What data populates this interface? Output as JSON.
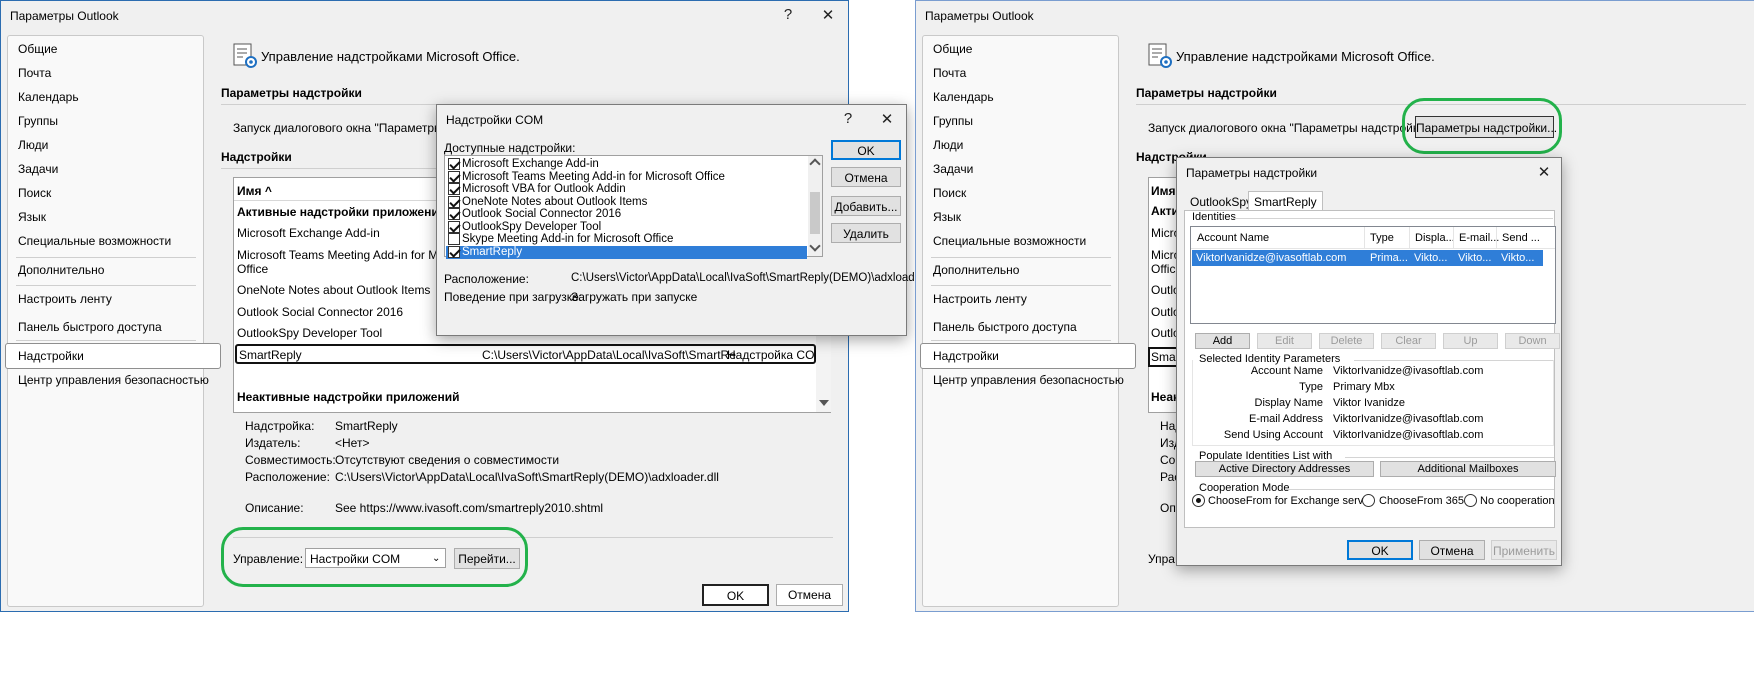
{
  "left": {
    "title": "Параметры Outlook",
    "help": "?",
    "close": "✕",
    "nav": [
      "Общие",
      "Почта",
      "Календарь",
      "Группы",
      "Люди",
      "Задачи",
      "Поиск",
      "Язык",
      "Специальные возможности",
      "Дополнительно",
      "Настроить ленту",
      "Панель быстрого доступа",
      "Надстройки",
      "Центр управления безопасностью"
    ],
    "nav_selected": "Надстройки",
    "header_title": "Управление надстройками Microsoft Office.",
    "params_heading": "Параметры надстройки",
    "params_launch": "Запуск диалогового окна \"Параметры на",
    "addins_heading": "Надстройки",
    "col_name": "Имя ^",
    "active_heading": "Активные надстройки приложений",
    "rows": [
      "Microsoft Exchange Add-in",
      "Microsoft Teams Meeting Add-in for Micro",
      "Office",
      "OneNote Notes about Outlook Items",
      "Outlook Social Connector 2016",
      "OutlookSpy Developer Tool"
    ],
    "sel_row": {
      "name": "SmartReply",
      "path": "C:\\Users\\Victor\\AppData\\Local\\IvaSoft\\SmartRe",
      "type": "Надстройка COM"
    },
    "inactive_heading": "Неактивные надстройки приложений",
    "details": [
      {
        "label": "Надстройка:",
        "value": "SmartReply"
      },
      {
        "label": "Издатель:",
        "value": "<Нет>"
      },
      {
        "label": "Совместимость:",
        "value": "Отсутствуют сведения о совместимости"
      },
      {
        "label": "Расположение:",
        "value": "C:\\Users\\Victor\\AppData\\Local\\IvaSoft\\SmartReply(DEMO)\\adxloader.dll"
      },
      {
        "label": "Описание:",
        "value": "See https://www.ivasoft.com/smartreply2010.shtml"
      }
    ],
    "manage_label": "Управление:",
    "manage_value": "Настройки COM",
    "go_button": "Перейти...",
    "ok": "OK",
    "cancel": "Отмена"
  },
  "com": {
    "title": "Надстройки COM",
    "help": "?",
    "close": "✕",
    "available_label": "Доступные надстройки:",
    "items": [
      {
        "label": "Microsoft Exchange Add-in",
        "checked": true
      },
      {
        "label": "Microsoft Teams Meeting Add-in for Microsoft Office",
        "checked": true
      },
      {
        "label": "Microsoft VBA for Outlook Addin",
        "checked": true
      },
      {
        "label": "OneNote Notes about Outlook Items",
        "checked": true
      },
      {
        "label": "Outlook Social Connector 2016",
        "checked": true
      },
      {
        "label": "OutlookSpy Developer Tool",
        "checked": true
      },
      {
        "label": "Skype Meeting Add-in for Microsoft Office",
        "checked": false
      },
      {
        "label": "SmartReply",
        "checked": true
      }
    ],
    "ok": "OK",
    "cancel": "Отмена",
    "add": "Добавить...",
    "remove": "Удалить",
    "location_label": "Расположение:",
    "location_value": "C:\\Users\\Victor\\AppData\\Local\\IvaSoft\\SmartReply(DEMO)\\adxloader.dll",
    "behavior_label": "Поведение при загрузке:",
    "behavior_value": "Загружать при запуске"
  },
  "right": {
    "title": "Параметры Outlook",
    "nav": [
      "Общие",
      "Почта",
      "Календарь",
      "Группы",
      "Люди",
      "Задачи",
      "Поиск",
      "Язык",
      "Специальные возможности",
      "Дополнительно",
      "Настроить ленту",
      "Панель быстрого доступа",
      "Надстройки",
      "Центр управления безопасностью"
    ],
    "nav_selected": "Надстройки",
    "header_title": "Управление надстройками Microsoft Office.",
    "params_heading": "Параметры надстройки",
    "params_launch": "Запуск диалогового окна \"Параметры надстройки\"",
    "params_button": "Параметры надстройки...",
    "addins_heading": "Надстройки",
    "peek": [
      "Имя",
      "Актив",
      "Micro",
      "Micro",
      "Offic",
      "Outlo",
      "Outlo",
      "Outlo",
      "Smar",
      "Неак",
      "Надс",
      "Изда",
      "Сов",
      "Рас",
      "Опи",
      "Упра"
    ]
  },
  "smartreply": {
    "title": "Параметры надстройки",
    "close": "✕",
    "tabs": [
      "OutlookSpy",
      "SmartReply"
    ],
    "identities_label": "Identities",
    "columns": [
      "Account Name",
      "Type",
      "Displa...",
      "E-mail...",
      "Send ..."
    ],
    "row": [
      "ViktorIvanidze@ivasoftlab.com",
      "Prima...",
      "Vikto...",
      "Vikto...",
      "Vikto..."
    ],
    "buttons": [
      {
        "label": "Add",
        "enabled": true
      },
      {
        "label": "Edit",
        "enabled": false
      },
      {
        "label": "Delete",
        "enabled": false
      },
      {
        "label": "Clear",
        "enabled": false
      },
      {
        "label": "Up",
        "enabled": false
      },
      {
        "label": "Down",
        "enabled": false
      }
    ],
    "sel_params_label": "Selected Identity Parameters",
    "params": [
      {
        "label": "Account Name",
        "value": "ViktorIvanidze@ivasoftlab.com"
      },
      {
        "label": "Type",
        "value": "Primary Mbx"
      },
      {
        "label": "Display Name",
        "value": "Viktor Ivanidze"
      },
      {
        "label": "E-mail Address",
        "value": "ViktorIvanidze@ivasoftlab.com"
      },
      {
        "label": "Send Using Account",
        "value": "ViktorIvanidze@ivasoftlab.com"
      }
    ],
    "populate_label": "Populate Identities List with",
    "ad_button": "Active Directory Addresses",
    "mailbox_button": "Additional Mailboxes",
    "coop_label": "Cooperation Mode",
    "coop_options": [
      {
        "label": "ChooseFrom for Exchange server",
        "selected": true
      },
      {
        "label": "ChooseFrom 365",
        "selected": false
      },
      {
        "label": "No cooperation",
        "selected": false
      }
    ],
    "ok": "OK",
    "cancel": "Отмена",
    "apply": "Применить"
  },
  "colors": {
    "accent": "#0078d7",
    "highlight": "#2f7ed8",
    "annotation": "#23b24b"
  }
}
